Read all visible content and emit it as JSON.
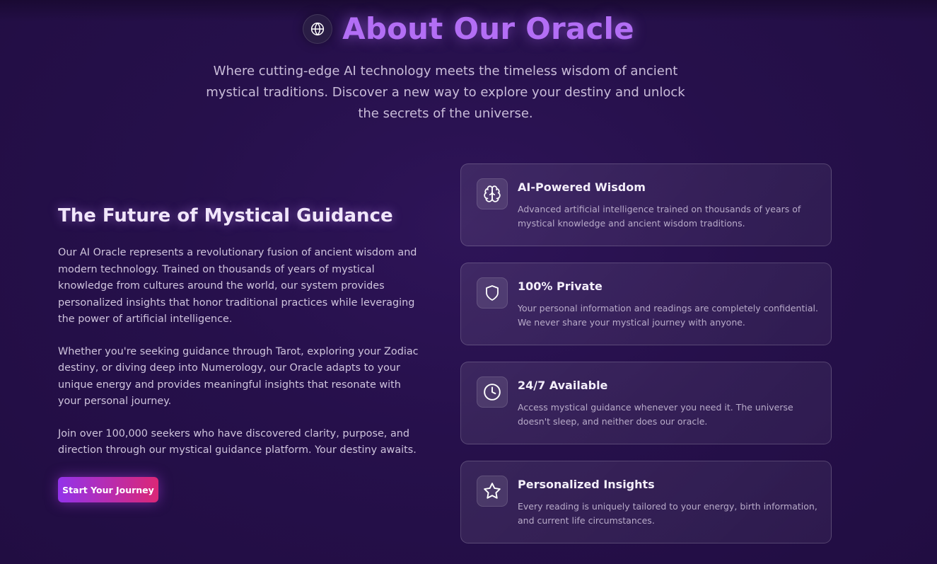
{
  "header": {
    "icon": "globe-icon",
    "title": "About Our Oracle",
    "subtitle": "Where cutting-edge AI technology meets the timeless wisdom of ancient mystical traditions. Discover a new way to explore your destiny and unlock the secrets of the universe."
  },
  "intro": {
    "title": "The Future of Mystical Guidance",
    "paragraphs": [
      "Our AI Oracle represents a revolutionary fusion of ancient wisdom and modern technology. Trained on thousands of years of mystical knowledge from cultures around the world, our system provides personalized insights that honor traditional practices while leveraging the power of artificial intelligence.",
      "Whether you're seeking guidance through Tarot, exploring your Zodiac destiny, or diving deep into Numerology, our Oracle adapts to your unique energy and provides meaningful insights that resonate with your personal journey.",
      "Join over 100,000 seekers who have discovered clarity, purpose, and direction through our mystical guidance platform. Your destiny awaits."
    ],
    "cta_label": "Start Your Journey"
  },
  "features": [
    {
      "icon": "brain-icon",
      "title": "AI-Powered Wisdom",
      "description": "Advanced artificial intelligence trained on thousands of years of mystical knowledge and ancient wisdom traditions."
    },
    {
      "icon": "shield-icon",
      "title": "100% Private",
      "description": "Your personal information and readings are completely confidential. We never share your mystical journey with anyone."
    },
    {
      "icon": "clock-icon",
      "title": "24/7 Available",
      "description": "Access mystical guidance whenever you need it. The universe doesn't sleep, and neither does our oracle."
    },
    {
      "icon": "star-icon",
      "title": "Personalized Insights",
      "description": "Every reading is uniquely tailored to your energy, birth information, and current life circumstances."
    }
  ],
  "colors": {
    "accent": "#b36ef5",
    "background": "#26104b",
    "cta_start": "#9333ea",
    "cta_end": "#db2777"
  }
}
